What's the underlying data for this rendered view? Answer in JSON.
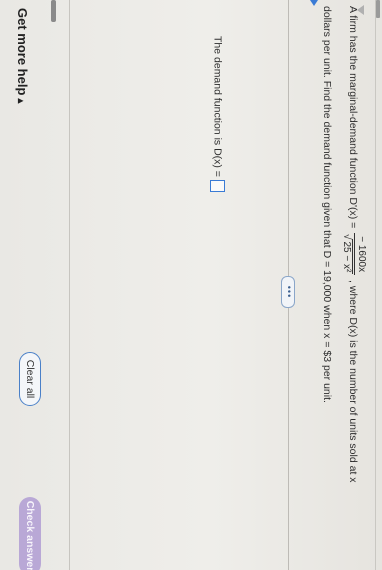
{
  "problem": {
    "intro": "A firm has the marginal-demand function D'(x) =",
    "fraction_numerator": "− 1600x",
    "fraction_denominator_radicand": "25 − x²",
    "after_fraction": ", where D(x) is the number of units sold at x",
    "line2": "dollars per unit. Find the demand function given that D = 19,000 when x = $3 per unit."
  },
  "more_button": {
    "label": "•••"
  },
  "answer": {
    "prompt": "The demand function is D(x) ="
  },
  "footer": {
    "help_label": "Get more help",
    "help_caret": "▴",
    "clear_label": "Clear all",
    "check_label": "Check answer"
  }
}
